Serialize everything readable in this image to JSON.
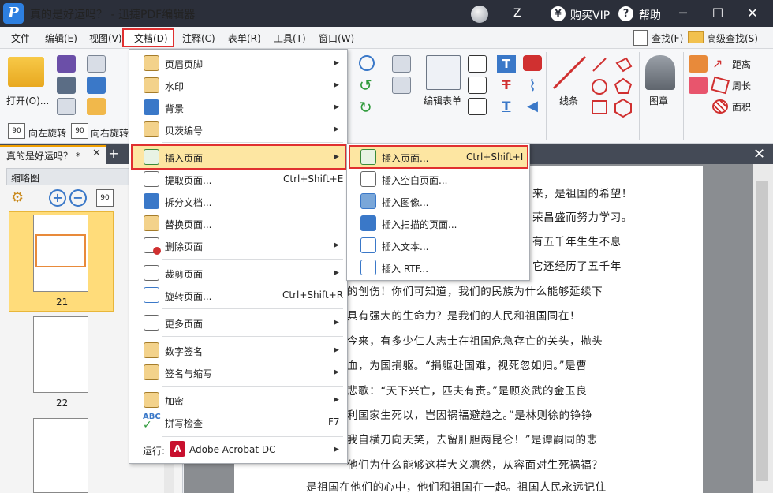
{
  "window": {
    "title": "真的是好运吗？ - 迅捷PDF编辑器",
    "user_name": "Z",
    "buy_vip": "购买VIP",
    "help": "帮助",
    "logo_glyph": "P"
  },
  "menubar": {
    "items": [
      "文件",
      "编辑(E)",
      "视图(V)",
      "文档(D)",
      "注释(C)",
      "表单(R)",
      "工具(T)",
      "窗口(W)"
    ],
    "find": "查找(F)",
    "advanced_find": "高级查找(S)"
  },
  "ribbon": {
    "open": "打开(O)...",
    "rotate_left": "向左旋转",
    "rotate_right": "向右旋转",
    "edit_form": "编辑表单",
    "line": "线条",
    "stamp": "图章",
    "distance": "距离",
    "perimeter": "周长",
    "area": "面积"
  },
  "tabs": {
    "document": "真的是好运吗？ *"
  },
  "thumbnails": {
    "title": "缩略图",
    "pages": [
      "21",
      "22"
    ]
  },
  "document_menu": {
    "items": [
      {
        "label": "页眉页脚",
        "shortcut": "",
        "submenu": true,
        "icon": "header-footer-icon"
      },
      {
        "label": "水印",
        "shortcut": "",
        "submenu": true,
        "icon": "watermark-icon"
      },
      {
        "label": "背景",
        "shortcut": "",
        "submenu": true,
        "icon": "background-icon"
      },
      {
        "label": "贝茨编号",
        "shortcut": "",
        "submenu": true,
        "icon": "bates-number-icon"
      },
      {
        "label": "插入页面",
        "shortcut": "",
        "submenu": true,
        "icon": "insert-page-icon"
      },
      {
        "label": "提取页面...",
        "shortcut": "Ctrl+Shift+E",
        "submenu": false,
        "icon": "extract-page-icon"
      },
      {
        "label": "拆分文档...",
        "shortcut": "",
        "submenu": false,
        "icon": "split-document-icon"
      },
      {
        "label": "替换页面...",
        "shortcut": "",
        "submenu": false,
        "icon": "replace-page-icon"
      },
      {
        "label": "删除页面",
        "shortcut": "",
        "submenu": true,
        "icon": "delete-page-icon"
      },
      {
        "label": "裁剪页面",
        "shortcut": "",
        "submenu": true,
        "icon": "crop-page-icon"
      },
      {
        "label": "旋转页面...",
        "shortcut": "Ctrl+Shift+R",
        "submenu": false,
        "icon": "rotate-page-icon"
      },
      {
        "label": "更多页面",
        "shortcut": "",
        "submenu": true,
        "icon": "more-pages-icon"
      },
      {
        "label": "数字签名",
        "shortcut": "",
        "submenu": true,
        "icon": "digital-signature-icon"
      },
      {
        "label": "签名与缩写",
        "shortcut": "",
        "submenu": true,
        "icon": "signature-initials-icon"
      },
      {
        "label": "加密",
        "shortcut": "",
        "submenu": true,
        "icon": "encrypt-icon"
      },
      {
        "label": "拼写检查",
        "shortcut": "F7",
        "submenu": false,
        "icon": "spell-check-icon"
      },
      {
        "label": "Adobe Acrobat DC",
        "prefix": "运行:",
        "shortcut": "",
        "submenu": true,
        "icon": "acrobat-icon"
      }
    ]
  },
  "insert_submenu": {
    "items": [
      {
        "label": "插入页面...",
        "shortcut": "Ctrl+Shift+I"
      },
      {
        "label": "插入空白页面...",
        "shortcut": ""
      },
      {
        "label": "插入图像...",
        "shortcut": ""
      },
      {
        "label": "插入扫描的页面...",
        "shortcut": ""
      },
      {
        "label": "插入文本...",
        "shortcut": ""
      },
      {
        "label": "插入 RTF...",
        "shortcut": ""
      }
    ]
  },
  "document_text": [
    "来，是祖国的希望！",
    "荣昌盛而努力学习。",
    "有五千年生生不息",
    "它还经历了五千年",
    "的创伤！你们可知道，我们的民族为什么能够延续下",
    "具有强大的生命力？是我们的人民和祖国同在！",
    "今来，有多少仁人志士在祖国危急存亡的关头，抛头",
    "血，为国捐躯。“捐躯赴国难，视死忽如归。”是曹",
    "悲歌：“天下兴亡，匹夫有责。”是顾炎武的金玉良",
    "利国家生死以，岂因祸福避趋之。”是林则徐的铮铮",
    "我自横刀向天笑，去留肝胆两昆仑！”是谭嗣同的悲",
    "他们为什么能够这样大义凛然，从容面对生死祸福？",
    "是祖国在他们的心中，他们和祖国在一起。祖国人民永远记住"
  ],
  "colors": {
    "titlebar": "#2b2f3a",
    "highlight": "#fde6a2",
    "red_frame": "#e03030",
    "accent_blue": "#2d7fe0"
  }
}
